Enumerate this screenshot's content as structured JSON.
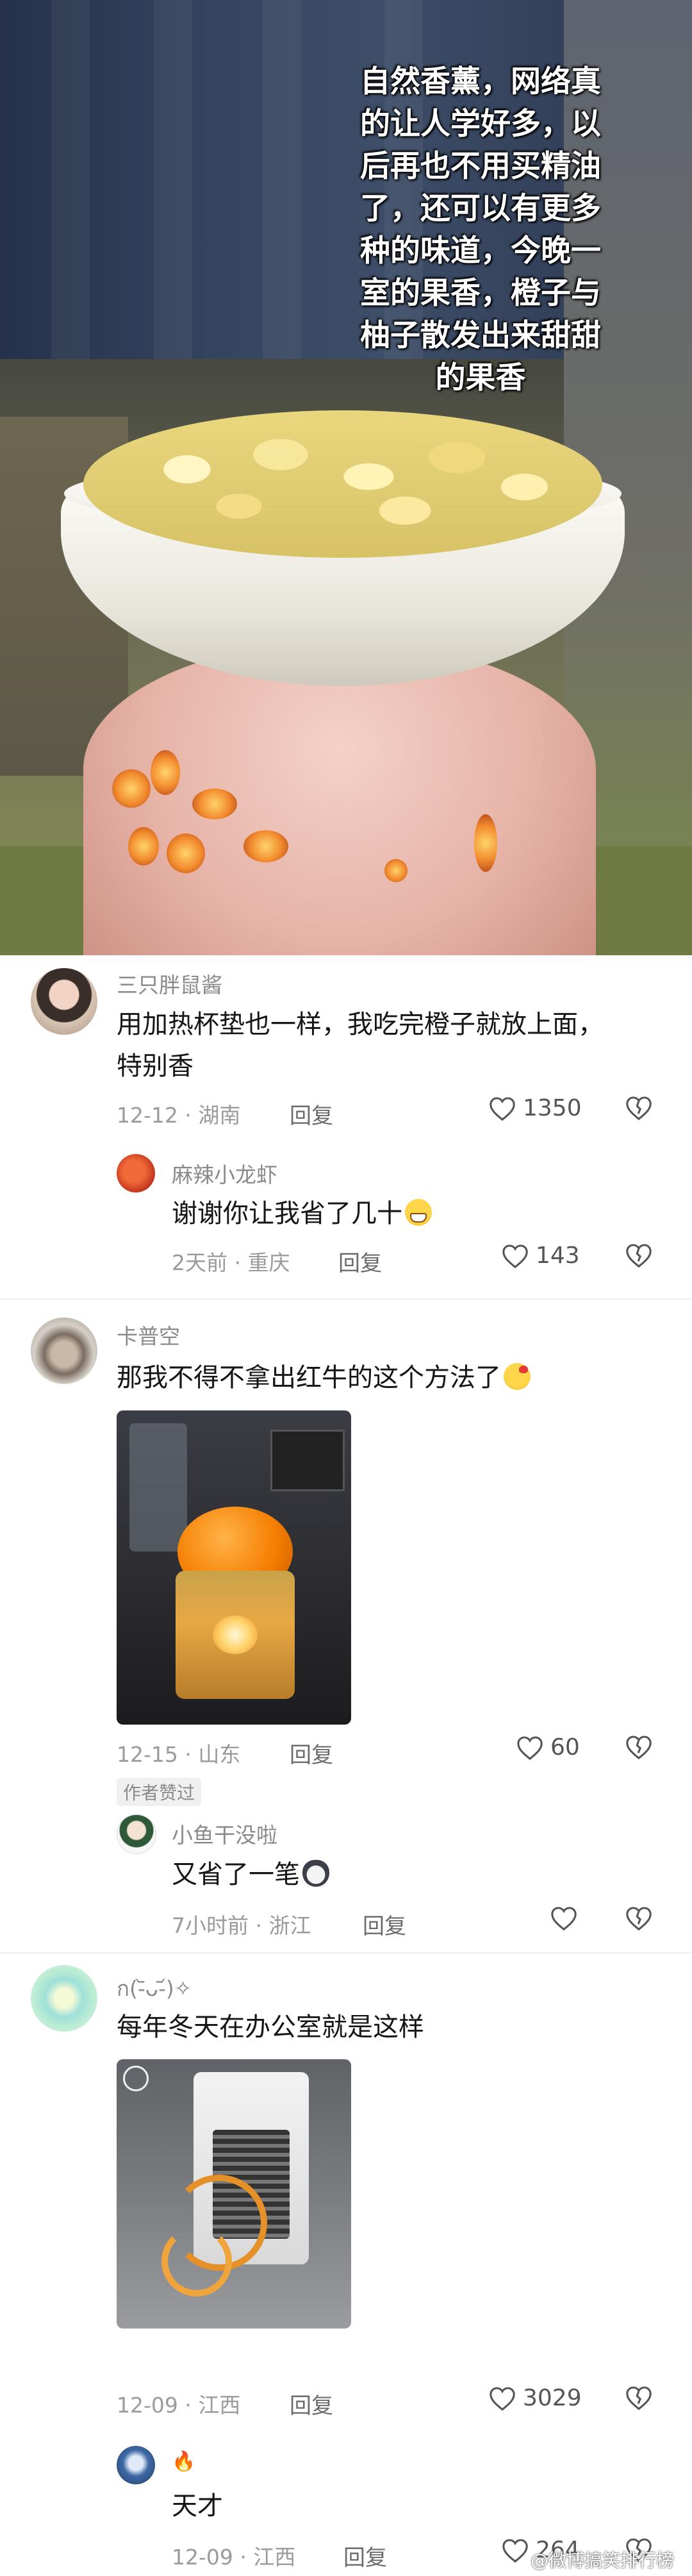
{
  "post": {
    "caption": "自然香薰，网络真\n的让人学好多，以\n后再也不用买精油\n了，还可以有更多\n种的味道，今晚一\n室的果香，橙子与\n柚子散发出来甜甜\n的果香"
  },
  "comments": [
    {
      "username": "三只胖鼠酱",
      "text_lines": [
        "用加热杯垫也一样，我吃完橙子就放上面，",
        "特别香"
      ],
      "date": "12-12",
      "location": "湖南",
      "reply_label": "回复",
      "likes": "1350",
      "replies": [
        {
          "username": "麻辣小龙虾",
          "text": "谢谢你让我省了几十",
          "emoji": "grin-icon",
          "date": "2天前",
          "location": "重庆",
          "reply_label": "回复",
          "likes": "143"
        }
      ]
    },
    {
      "username": "卡普空",
      "text": "那我不得不拿出红牛的这个方法了",
      "emoji": "kiss-icon",
      "date": "12-15",
      "location": "山东",
      "reply_label": "回复",
      "likes": "60",
      "author_tag": "作者赞过",
      "replies": [
        {
          "username": "小鱼干没啦",
          "text": "又省了一笔",
          "emoji": "cat-icon",
          "date": "7小时前",
          "location": "浙江",
          "reply_label": "回复",
          "likes": ""
        }
      ]
    },
    {
      "username": "ก(-᷅ᴗ-᷄)✧",
      "text": "每年冬天在办公室就是这样",
      "date": "12-09",
      "location": "江西",
      "reply_label": "回复",
      "likes": "3029",
      "replies": [
        {
          "username": "🔥",
          "text": "天才",
          "date": "12-09",
          "location": "江西",
          "reply_label": "回复",
          "likes": "264"
        }
      ]
    }
  ],
  "separator": " · ",
  "watermark": "@微博搞笑排行榜",
  "icons": {
    "like": "heart-icon",
    "dislike": "broken-heart-icon"
  },
  "colors": {
    "meta": "#9b9b9b",
    "username": "#8a8a8a",
    "text": "#161616"
  }
}
